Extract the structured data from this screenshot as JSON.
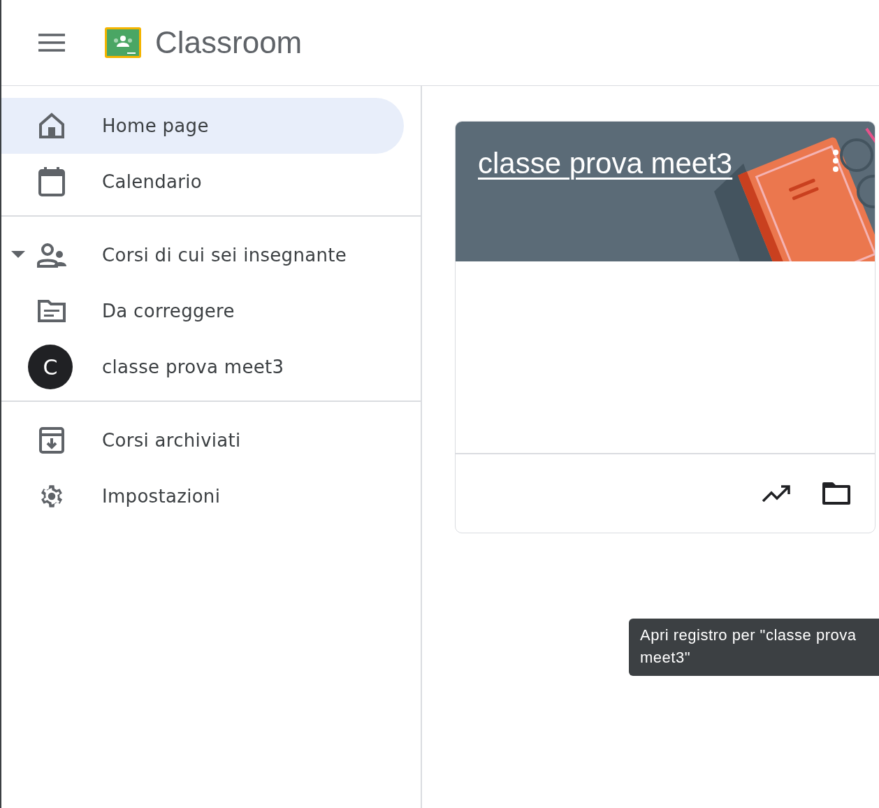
{
  "header": {
    "title": "Classroom"
  },
  "sidebar": {
    "sections": [
      [
        {
          "kind": "home",
          "label": "Home page",
          "selected": true
        },
        {
          "kind": "calendar",
          "label": "Calendario",
          "selected": false
        }
      ],
      [
        {
          "kind": "teaching",
          "label": "Corsi di cui sei insegnante",
          "selected": false,
          "expanded": true
        },
        {
          "kind": "review",
          "label": "Da correggere",
          "selected": false
        },
        {
          "kind": "course",
          "label": "classe prova meet3",
          "selected": false,
          "initial": "C"
        }
      ],
      [
        {
          "kind": "archive",
          "label": "Corsi archiviati",
          "selected": false
        },
        {
          "kind": "settings",
          "label": "Impostazioni",
          "selected": false
        }
      ]
    ]
  },
  "course_card": {
    "title": "classe prova meet3",
    "tooltip": "Apri registro per \"classe prova meet3\""
  }
}
